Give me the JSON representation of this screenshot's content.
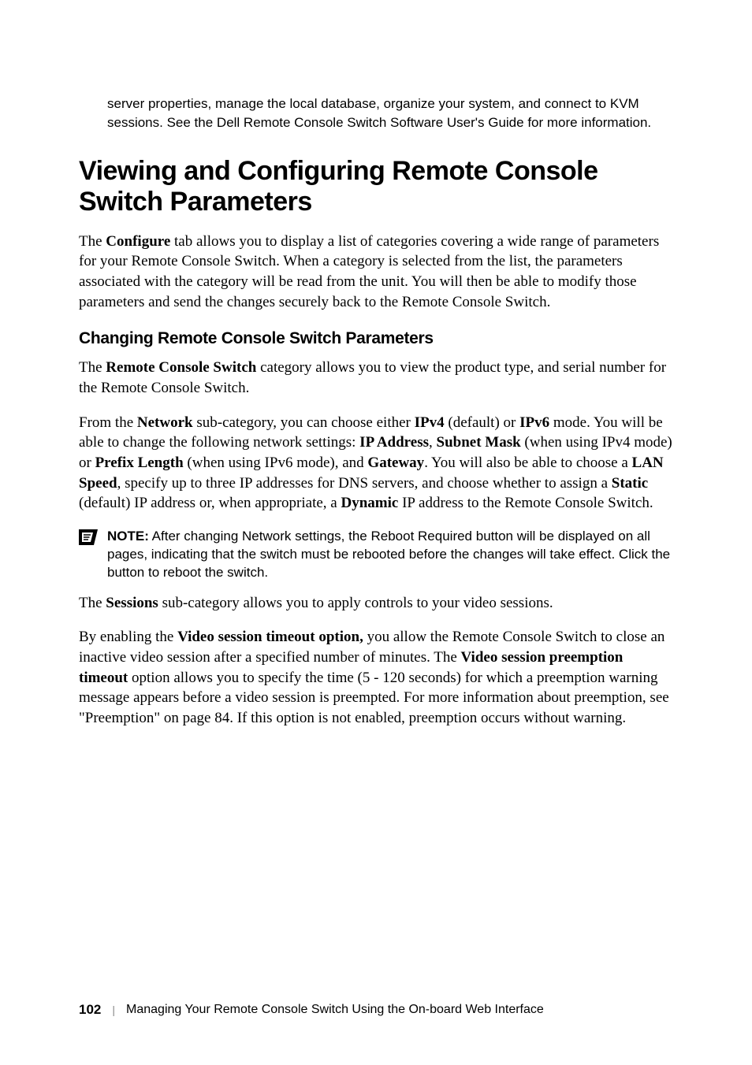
{
  "intro": "server properties, manage the local database, organize your system, and connect to KVM sessions. See the Dell Remote Console Switch Software User's Guide for more information.",
  "h1": "Viewing and Configuring Remote Console Switch Parameters",
  "para_configure_1": "The ",
  "para_configure_bold1": "Configure",
  "para_configure_2": " tab allows you to display a list of categories covering a wide range of parameters for your Remote Console Switch. When a category is selected from the list, the parameters associated with the category will be read from the unit. You will then be able to modify those parameters and send the changes securely back to the Remote Console Switch.",
  "h2": "Changing Remote Console Switch Parameters",
  "para_rcs_1": "The ",
  "para_rcs_bold1": "Remote Console Switch",
  "para_rcs_2": " category allows you to view the product type, and serial number for the Remote Console Switch.",
  "net_1": "From the ",
  "net_bold1": "Network",
  "net_2": " sub-category, you can choose either ",
  "net_bold2": "IPv4",
  "net_3": " (default) or ",
  "net_bold3": "IPv6",
  "net_4": " mode. You will be able to change the following network settings: ",
  "net_bold4": "IP Address",
  "net_5": ", ",
  "net_bold5": "Subnet Mask",
  "net_6": " (when using IPv4 mode) or ",
  "net_bold6": "Prefix Length",
  "net_7": " (when using IPv6 mode), and ",
  "net_bold7": "Gateway",
  "net_8": ". You will also be able to choose a ",
  "net_bold8": "LAN Speed",
  "net_9": ", specify up to three IP addresses for DNS servers, and choose whether to assign a ",
  "net_bold9": "Static",
  "net_10": " (default) IP address or, when appropriate, a ",
  "net_bold10": "Dynamic",
  "net_11": " IP address to the Remote Console Switch.",
  "note_label": "NOTE:",
  "note_text": " After changing Network settings, the Reboot Required button will be displayed on all pages, indicating that the switch must be rebooted before the changes will take effect. Click the button to reboot the switch.",
  "sess_1": "The ",
  "sess_bold1": "Sessions",
  "sess_2": " sub-category allows you to apply controls to your video sessions.",
  "vid_1": "By enabling the ",
  "vid_bold1": "Video session timeout option,",
  "vid_2": " you allow the Remote Console Switch to close an inactive video session after a specified number of minutes. The ",
  "vid_bold2": "Video session preemption timeout",
  "vid_3": " option allows you to specify the time (5 - 120 seconds) for which a preemption warning message appears before a video session is preempted. For more information about preemption, see \"Preemption\" on page 84. If this option is not enabled, preemption occurs without warning.",
  "footer_page": "102",
  "footer_sep": "|",
  "footer_text": "Managing Your Remote Console Switch Using the On-board Web Interface"
}
